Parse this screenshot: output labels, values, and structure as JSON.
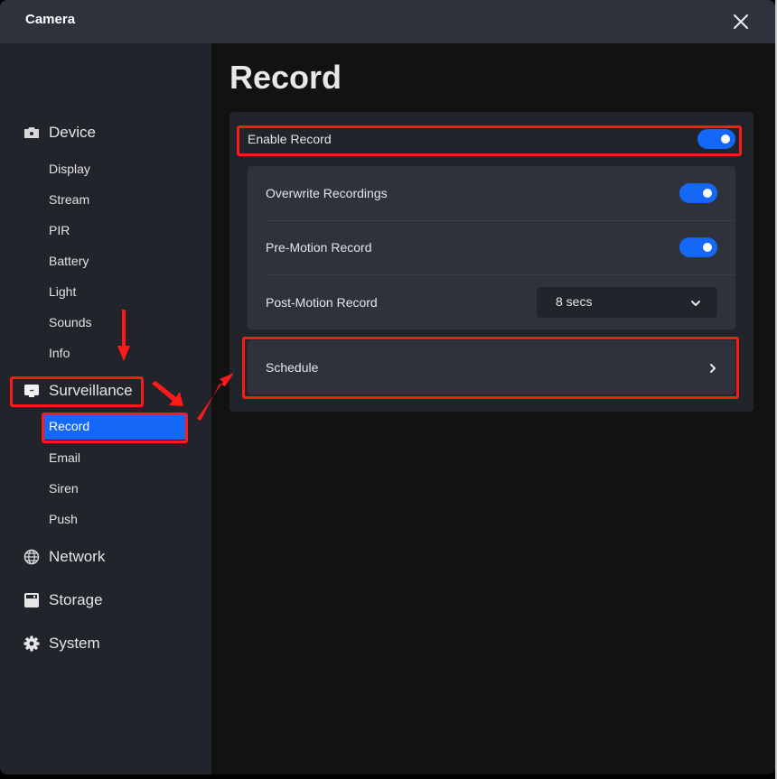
{
  "window": {
    "title": "Camera",
    "close_icon": "close-icon"
  },
  "sidebar": {
    "groups": [
      {
        "label": "Device",
        "icon": "camera-icon",
        "items": [
          "Display",
          "Stream",
          "PIR",
          "Battery",
          "Light",
          "Sounds",
          "Info"
        ]
      },
      {
        "label": "Surveillance",
        "icon": "monitor-icon",
        "items": [
          "Record",
          "Email",
          "Siren",
          "Push"
        ],
        "active_item": "Record"
      },
      {
        "label": "Network",
        "icon": "globe-icon",
        "items": []
      },
      {
        "label": "Storage",
        "icon": "storage-icon",
        "items": []
      },
      {
        "label": "System",
        "icon": "gear-icon",
        "items": []
      }
    ]
  },
  "main": {
    "title": "Record",
    "enable_record": {
      "label": "Enable Record",
      "on": true
    },
    "settings": [
      {
        "label": "Overwrite Recordings",
        "type": "toggle",
        "on": true
      },
      {
        "label": "Pre-Motion Record",
        "type": "toggle",
        "on": true
      },
      {
        "label": "Post-Motion Record",
        "type": "select",
        "value": "8 secs"
      }
    ],
    "schedule": {
      "label": "Schedule",
      "icon": "chevron-right-icon"
    }
  },
  "annotations": {
    "highlight_color": "#ff1a1a",
    "highlighted": [
      "Surveillance",
      "Record",
      "Enable Record",
      "Schedule"
    ]
  },
  "colors": {
    "accent": "#1567f5",
    "titlebar": "#2d323c",
    "sidebar": "#21242b",
    "main": "#121212"
  }
}
